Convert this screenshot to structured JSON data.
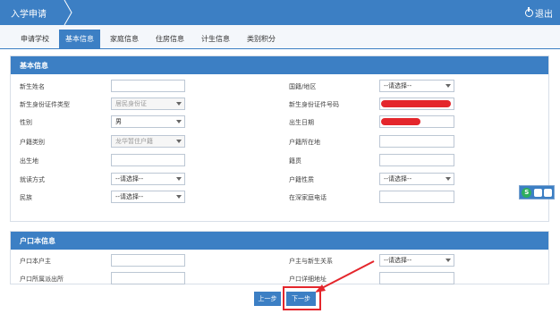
{
  "topbar": {
    "breadcrumb": "入学申请",
    "logout_label": "退出"
  },
  "tabs": [
    {
      "label": "申请学校",
      "active": false
    },
    {
      "label": "基本信息",
      "active": true
    },
    {
      "label": "家庭信息",
      "active": false
    },
    {
      "label": "住房信息",
      "active": false
    },
    {
      "label": "计生信息",
      "active": false
    },
    {
      "label": "类别积分",
      "active": false
    }
  ],
  "basic": {
    "title": "基本信息",
    "left": [
      {
        "label": "新生姓名",
        "value": ""
      },
      {
        "label": "新生身份证件类型",
        "value": "居民身份证"
      },
      {
        "label": "性别",
        "value": "男"
      },
      {
        "label": "户籍类别",
        "value": "龙华暂住户籍"
      },
      {
        "label": "出生地",
        "value": ""
      },
      {
        "label": "就读方式",
        "value": "--请选择--"
      },
      {
        "label": "民族",
        "value": "--请选择--"
      }
    ],
    "right": [
      {
        "label": "国籍/地区",
        "value": "--请选择--"
      },
      {
        "label": "新生身份证件号码",
        "value": ""
      },
      {
        "label": "出生日期",
        "value": ""
      },
      {
        "label": "户籍所在地",
        "value": ""
      },
      {
        "label": "籍贯",
        "value": ""
      },
      {
        "label": "户籍性质",
        "value": "--请选择--"
      },
      {
        "label": "在深家庭电话",
        "value": ""
      }
    ]
  },
  "household": {
    "title": "户口本信息",
    "left": [
      {
        "label": "户口本户主",
        "value": ""
      },
      {
        "label": "户口所属派出所",
        "value": ""
      }
    ],
    "right": [
      {
        "label": "户主与新生关系",
        "value": "--请选择--"
      },
      {
        "label": "户口详细地址",
        "value": ""
      }
    ]
  },
  "buttons": {
    "prev": "上一步",
    "next": "下一步"
  },
  "widget": {
    "label": "S"
  },
  "colors": {
    "primary": "#3c7fc4",
    "redact": "#e4262c"
  }
}
